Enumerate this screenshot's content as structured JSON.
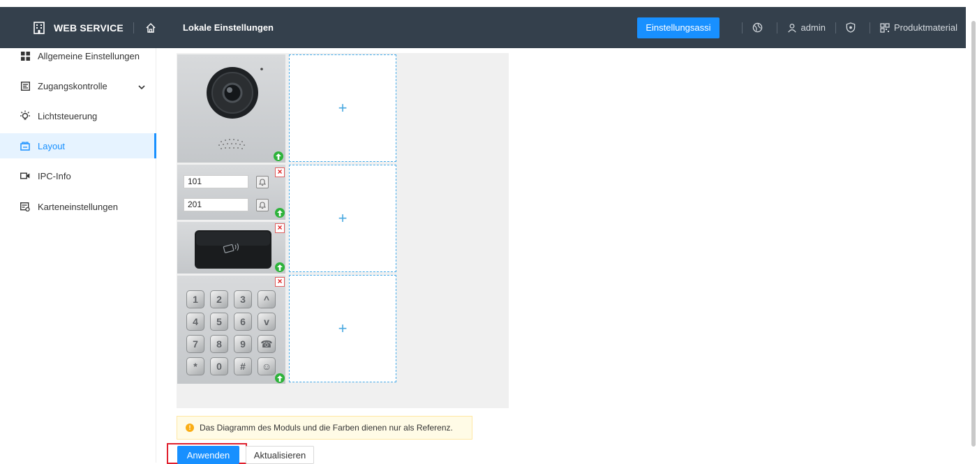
{
  "header": {
    "app_title": "WEB SERVICE",
    "page_title": "Lokale Einstellungen",
    "assistant_button": "Einstellungsassi",
    "user": "admin",
    "product_material": "Produktmaterial"
  },
  "sidebar": {
    "items": [
      {
        "label": "Allgemeine Einstellungen",
        "icon": "grid-icon"
      },
      {
        "label": "Zugangskontrolle",
        "icon": "access-icon"
      },
      {
        "label": "Lichtsteuerung",
        "icon": "bulb-icon"
      },
      {
        "label": "Layout",
        "icon": "layout-icon"
      },
      {
        "label": "IPC-Info",
        "icon": "camera-icon"
      },
      {
        "label": "Karteneinstellungen",
        "icon": "card-settings-icon"
      }
    ],
    "active": "Layout"
  },
  "layout": {
    "rooms": [
      "101",
      "201"
    ],
    "keypad_keys": [
      "1",
      "2",
      "3",
      "^",
      "4",
      "5",
      "6",
      "v",
      "7",
      "8",
      "9",
      "☎",
      "*",
      "0",
      "#",
      "☺"
    ],
    "add_symbol": "+",
    "delete_symbol": "×"
  },
  "notice": "Das Diagramm des Moduls und die Farben dienen nur als Referenz.",
  "actions": {
    "apply": "Anwenden",
    "refresh": "Aktualisieren"
  },
  "colors": {
    "topbar": "#34404c",
    "accent": "#1890ff",
    "highlight": "#e0202e"
  }
}
